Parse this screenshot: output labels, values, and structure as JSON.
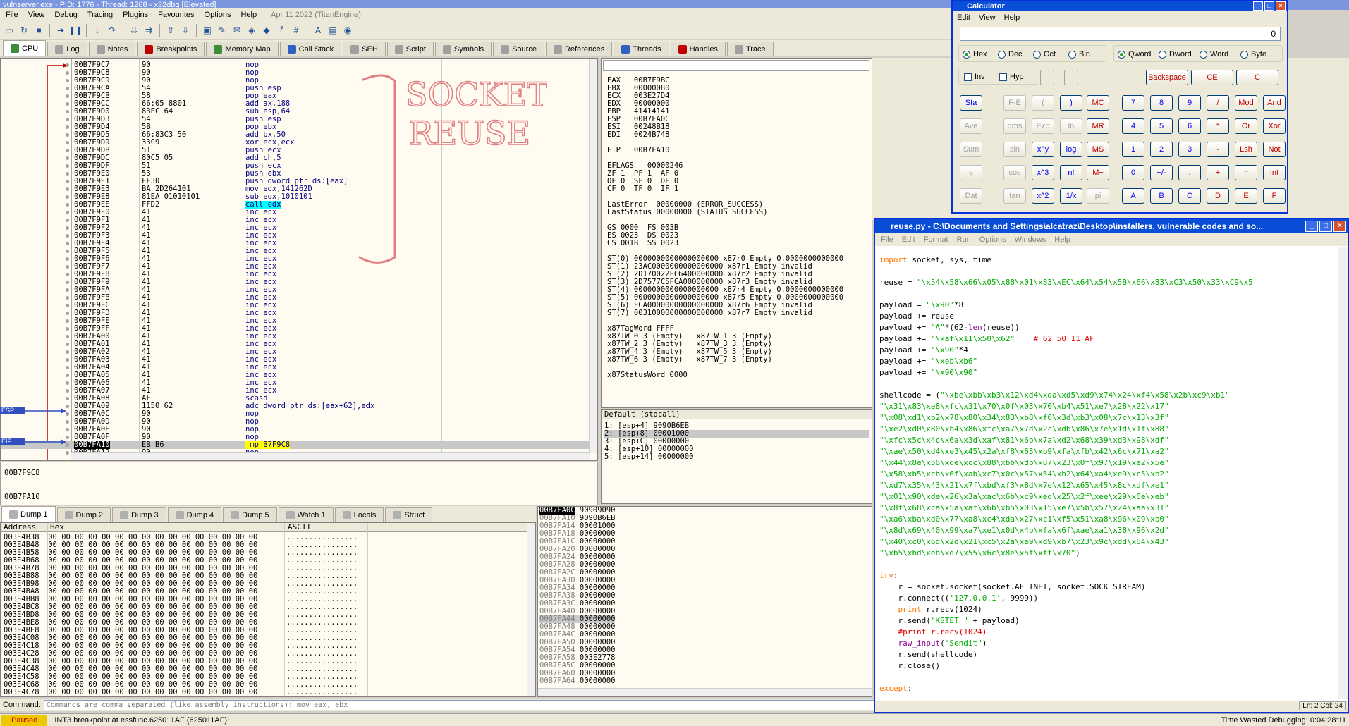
{
  "xdbg": {
    "title": "vulnserver.exe - PID: 1776 - Thread: 1268 - x32dbg [Elevated]",
    "menu": [
      "File",
      "View",
      "Debug",
      "Tracing",
      "Plugins",
      "Favourites",
      "Options",
      "Help"
    ],
    "menu_date": "Apr 11 2022 (TitanEngine)",
    "tabs": [
      {
        "label": "CPU",
        "color": "#3c8c3c"
      },
      {
        "label": "Log",
        "color": "#a0a0a0"
      },
      {
        "label": "Notes",
        "color": "#a0a0a0"
      },
      {
        "label": "Breakpoints",
        "color": "#c00000"
      },
      {
        "label": "Memory Map",
        "color": "#3c8c3c"
      },
      {
        "label": "Call Stack",
        "color": "#3060c0"
      },
      {
        "label": "SEH",
        "color": "#a0a0a0"
      },
      {
        "label": "Script",
        "color": "#a0a0a0"
      },
      {
        "label": "Symbols",
        "color": "#a0a0a0"
      },
      {
        "label": "Source",
        "color": "#a0a0a0"
      },
      {
        "label": "References",
        "color": "#a0a0a0"
      },
      {
        "label": "Threads",
        "color": "#3060c0"
      },
      {
        "label": "Handles",
        "color": "#c00000"
      },
      {
        "label": "Trace",
        "color": "#a0a0a0"
      }
    ],
    "disasm": [
      {
        "addr": "00B7F9C7",
        "bytes": "90",
        "ins": "nop"
      },
      {
        "addr": "00B7F9C8",
        "bytes": "90",
        "ins": "nop"
      },
      {
        "addr": "00B7F9C9",
        "bytes": "90",
        "ins": "nop"
      },
      {
        "addr": "00B7F9CA",
        "bytes": "54",
        "ins": "push esp"
      },
      {
        "addr": "00B7F9CB",
        "bytes": "58",
        "ins": "pop eax"
      },
      {
        "addr": "00B7F9CC",
        "bytes": "66:05 8801",
        "ins": "add ax,188"
      },
      {
        "addr": "00B7F9D0",
        "bytes": "83EC 64",
        "ins": "sub esp,64"
      },
      {
        "addr": "00B7F9D3",
        "bytes": "54",
        "ins": "push esp"
      },
      {
        "addr": "00B7F9D4",
        "bytes": "5B",
        "ins": "pop ebx"
      },
      {
        "addr": "00B7F9D5",
        "bytes": "66:83C3 50",
        "ins": "add bx,50"
      },
      {
        "addr": "00B7F9D9",
        "bytes": "33C9",
        "ins": "xor ecx,ecx"
      },
      {
        "addr": "00B7F9DB",
        "bytes": "51",
        "ins": "push ecx"
      },
      {
        "addr": "00B7F9DC",
        "bytes": "80C5 05",
        "ins": "add ch,5"
      },
      {
        "addr": "00B7F9DF",
        "bytes": "51",
        "ins": "push ecx"
      },
      {
        "addr": "00B7F9E0",
        "bytes": "53",
        "ins": "push ebx"
      },
      {
        "addr": "00B7F9E1",
        "bytes": "FF30",
        "ins": "push dword ptr ds:[eax]"
      },
      {
        "addr": "00B7F9E3",
        "bytes": "BA 2D264101",
        "ins": "mov edx,141262D"
      },
      {
        "addr": "00B7F9E8",
        "bytes": "81EA 01010101",
        "ins": "sub edx,1010101"
      },
      {
        "addr": "00B7F9EE",
        "bytes": "FFD2",
        "ins": "call edx"
      },
      {
        "addr": "00B7F9F0",
        "bytes": "41",
        "ins": "inc ecx"
      },
      {
        "addr": "00B7F9F1",
        "bytes": "41",
        "ins": "inc ecx"
      },
      {
        "addr": "00B7F9F2",
        "bytes": "41",
        "ins": "inc ecx"
      },
      {
        "addr": "00B7F9F3",
        "bytes": "41",
        "ins": "inc ecx"
      },
      {
        "addr": "00B7F9F4",
        "bytes": "41",
        "ins": "inc ecx"
      },
      {
        "addr": "00B7F9F5",
        "bytes": "41",
        "ins": "inc ecx"
      },
      {
        "addr": "00B7F9F6",
        "bytes": "41",
        "ins": "inc ecx"
      },
      {
        "addr": "00B7F9F7",
        "bytes": "41",
        "ins": "inc ecx"
      },
      {
        "addr": "00B7F9F8",
        "bytes": "41",
        "ins": "inc ecx"
      },
      {
        "addr": "00B7F9F9",
        "bytes": "41",
        "ins": "inc ecx"
      },
      {
        "addr": "00B7F9FA",
        "bytes": "41",
        "ins": "inc ecx"
      },
      {
        "addr": "00B7F9FB",
        "bytes": "41",
        "ins": "inc ecx"
      },
      {
        "addr": "00B7F9FC",
        "bytes": "41",
        "ins": "inc ecx"
      },
      {
        "addr": "00B7F9FD",
        "bytes": "41",
        "ins": "inc ecx"
      },
      {
        "addr": "00B7F9FE",
        "bytes": "41",
        "ins": "inc ecx"
      },
      {
        "addr": "00B7F9FF",
        "bytes": "41",
        "ins": "inc ecx"
      },
      {
        "addr": "00B7FA00",
        "bytes": "41",
        "ins": "inc ecx"
      },
      {
        "addr": "00B7FA01",
        "bytes": "41",
        "ins": "inc ecx"
      },
      {
        "addr": "00B7FA02",
        "bytes": "41",
        "ins": "inc ecx"
      },
      {
        "addr": "00B7FA03",
        "bytes": "41",
        "ins": "inc ecx"
      },
      {
        "addr": "00B7FA04",
        "bytes": "41",
        "ins": "inc ecx"
      },
      {
        "addr": "00B7FA05",
        "bytes": "41",
        "ins": "inc ecx"
      },
      {
        "addr": "00B7FA06",
        "bytes": "41",
        "ins": "inc ecx"
      },
      {
        "addr": "00B7FA07",
        "bytes": "41",
        "ins": "inc ecx"
      },
      {
        "addr": "00B7FA08",
        "bytes": "AF",
        "ins": "scasd"
      },
      {
        "addr": "00B7FA09",
        "bytes": "1150 62",
        "ins": "adc dword ptr ds:[eax+62],edx"
      },
      {
        "addr": "00B7FA0C",
        "bytes": "90",
        "ins": "nop"
      },
      {
        "addr": "00B7FA0D",
        "bytes": "90",
        "ins": "nop"
      },
      {
        "addr": "00B7FA0E",
        "bytes": "90",
        "ins": "nop"
      },
      {
        "addr": "00B7FA0F",
        "bytes": "90",
        "ins": "nop"
      },
      {
        "addr": "00B7FA10",
        "bytes": "EB B6",
        "ins": "jmp B7F9C8"
      },
      {
        "addr": "00B7FA12",
        "bytes": "90",
        "ins": "nop"
      }
    ],
    "esp_label": "ESP",
    "eip_label": "EIP",
    "annotation": "SOCKET REUSE",
    "info_line1": "00B7F9C8",
    "info_line2": "00B7FA10",
    "registers": "EAX   00B7F9BC\nEBX   00000080\nECX   003E27D4\nEDX   00000000\nEBP   41414141\nESP   00B7FA0C\nESI   00248B18\nEDI   0024B748\n\nEIP   00B7FA10\n\nEFLAGS   00000246\nZF 1  PF 1  AF 0\nOF 0  SF 0  DF 0\nCF 0  TF 0  IF 1\n\nLastError  00000000 (ERROR_SUCCESS)\nLastStatus 00000000 (STATUS_SUCCESS)\n\nGS 0000  FS 003B\nES 0023  DS 0023\nCS 001B  SS 0023\n\nST(0) 0000000000000000000 x87r0 Empty 0.0000000000000\nST(1) 23AC0000000000000000 x87r1 Empty invalid\nST(2) 2D170022FC6400000000 x87r2 Empty invalid\nST(3) 2D7577C5FCA000000000 x87r3 Empty invalid\nST(4) 0000000000000000000 x87r4 Empty 0.0000000000000\nST(5) 0000000000000000000 x87r5 Empty 0.0000000000000\nST(6) FCA00000000000000000 x87r6 Empty invalid\nST(7) 00310000000000000000 x87r7 Empty invalid\n\nx87TagWord FFFF\nx87TW_0 3 (Empty)   x87TW_1 3 (Empty)\nx87TW_2 3 (Empty)   x87TW_3 3 (Empty)\nx87TW_4 3 (Empty)   x87TW_5 3 (Empty)\nx87TW_6 3 (Empty)   x87TW_7 3 (Empty)\n\nx87StatusWord 0000",
    "callconv": "Default (stdcall)",
    "callargs": [
      "1: [esp+4] 9090B6EB",
      "2: [esp+8] 00001000",
      "3: [esp+C] 00000000",
      "4: [esp+10] 00000000",
      "5: [esp+14] 00000000"
    ],
    "dump_tabs": [
      "Dump 1",
      "Dump 2",
      "Dump 3",
      "Dump 4",
      "Dump 5",
      "Watch 1",
      "Locals",
      "Struct"
    ],
    "dump_header": {
      "address": "Address",
      "hex": "Hex",
      "ascii": "ASCII"
    },
    "dump_addrs": [
      "003E4B38",
      "003E4B48",
      "003E4B58",
      "003E4B68",
      "003E4B78",
      "003E4B88",
      "003E4B98",
      "003E4BA8",
      "003E4BB8",
      "003E4BC8",
      "003E4BD8",
      "003E4BE8",
      "003E4BF8",
      "003E4C08",
      "003E4C18",
      "003E4C28",
      "003E4C38",
      "003E4C48",
      "003E4C58",
      "003E4C68",
      "003E4C78"
    ],
    "dump_hex": "00 00 00 00 00 00 00 00 00 00 00 00 00 00 00 00",
    "dump_ascii": "................",
    "stack": [
      {
        "addr": "00B7FA0C",
        "val": "90909090"
      },
      {
        "addr": "00B7FA10",
        "val": "9090B6EB"
      },
      {
        "addr": "00B7FA14",
        "val": "00001000"
      },
      {
        "addr": "00B7FA18",
        "val": "00000000"
      },
      {
        "addr": "00B7FA1C",
        "val": "00000000"
      },
      {
        "addr": "00B7FA20",
        "val": "00000000"
      },
      {
        "addr": "00B7FA24",
        "val": "00000000"
      },
      {
        "addr": "00B7FA28",
        "val": "00000000"
      },
      {
        "addr": "00B7FA2C",
        "val": "00000000"
      },
      {
        "addr": "00B7FA30",
        "val": "00000000"
      },
      {
        "addr": "00B7FA34",
        "val": "00000000"
      },
      {
        "addr": "00B7FA38",
        "val": "00000000"
      },
      {
        "addr": "00B7FA3C",
        "val": "00000000"
      },
      {
        "addr": "00B7FA40",
        "val": "00000000"
      },
      {
        "addr": "00B7FA44",
        "val": "00000000"
      },
      {
        "addr": "00B7FA48",
        "val": "00000000"
      },
      {
        "addr": "00B7FA4C",
        "val": "00000000"
      },
      {
        "addr": "00B7FA50",
        "val": "00000000"
      },
      {
        "addr": "00B7FA54",
        "val": "00000000"
      },
      {
        "addr": "00B7FA58",
        "val": "003E2778"
      },
      {
        "addr": "00B7FA5C",
        "val": "00000000"
      },
      {
        "addr": "00B7FA60",
        "val": "00000000"
      },
      {
        "addr": "00B7FA64",
        "val": "00000000"
      }
    ],
    "cmd_label": "Command:",
    "cmd_placeholder": "Commands are comma separated (like assembly instructions): mov eax, ebx",
    "status_paused": "Paused",
    "status_msg": "INT3 breakpoint at essfunc.625011AF (625011AF)!",
    "status_wasted": "Time Wasted Debugging: 0:04:28:11"
  },
  "calc": {
    "title": "Calculator",
    "menu": [
      "Edit",
      "View",
      "Help"
    ],
    "display": "0",
    "bases": [
      "Hex",
      "Dec",
      "Oct",
      "Bin"
    ],
    "words": [
      "Qword",
      "Dword",
      "Word",
      "Byte"
    ],
    "inv": "Inv",
    "hyp": "Hyp",
    "top_btns": [
      "Backspace",
      "CE",
      "C"
    ],
    "left_col": [
      "Sta",
      "Ave",
      "Sum",
      "s",
      "Dat"
    ],
    "sci": [
      [
        "F-E",
        "(",
        ")"
      ],
      [
        "dms",
        "Exp",
        "ln"
      ],
      [
        "sin",
        "x^y",
        "log"
      ],
      [
        "cos",
        "x^3",
        "n!"
      ],
      [
        "tan",
        "x^2",
        "1/x"
      ]
    ],
    "mem": [
      "MC",
      "MR",
      "MS",
      "M+",
      "pi"
    ],
    "nums": [
      [
        "7",
        "8",
        "9",
        "/",
        "Mod",
        "And"
      ],
      [
        "4",
        "5",
        "6",
        "*",
        "Or",
        "Xor"
      ],
      [
        "1",
        "2",
        "3",
        "-",
        "Lsh",
        "Not"
      ],
      [
        "0",
        "+/-",
        ".",
        "+",
        "=",
        "Int"
      ],
      [
        "A",
        "B",
        "C",
        "D",
        "E",
        "F"
      ]
    ]
  },
  "idle": {
    "title": "reuse.py - C:\\Documents and Settings\\alcatraz\\Desktop\\installers, vulnerable codes and so...",
    "menu": [
      "File",
      "Edit",
      "Format",
      "Run",
      "Options",
      "Windows",
      "Help"
    ],
    "status": "Ln: 2 Col: 24"
  }
}
